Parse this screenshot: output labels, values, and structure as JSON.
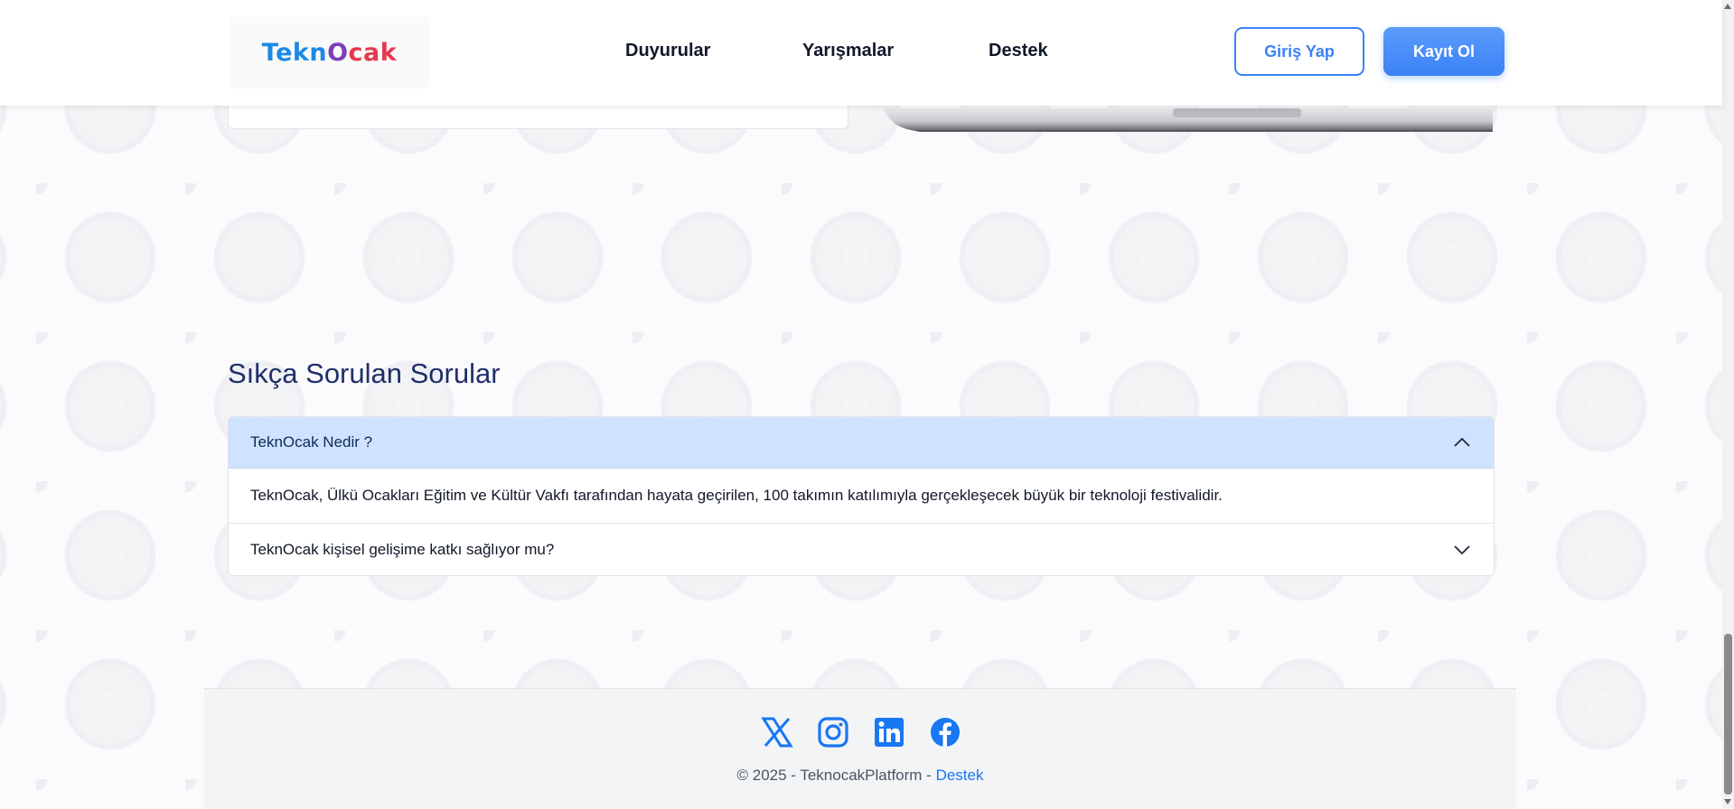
{
  "header": {
    "logo_text": [
      "Tekn",
      "O",
      "cak"
    ],
    "nav": [
      "Duyurular",
      "Yarışmalar",
      "Destek"
    ],
    "login_label": "Giriş Yap",
    "register_label": "Kayıt Ol"
  },
  "faq": {
    "title": "Sıkça Sorulan Sorular",
    "items": [
      {
        "question": "TeknOcak Nedir ?",
        "answer": "TeknOcak, Ülkü Ocakları Eğitim ve Kültür Vakfı tarafından hayata geçirilen, 100 takımın katılımıyla gerçekleşecek büyük bir teknoloji festivalidir.",
        "expanded": true
      },
      {
        "question": "TeknOcak kişisel gelişime katkı sağlıyor mu?",
        "expanded": false
      }
    ]
  },
  "footer": {
    "social_icons": [
      "x-icon",
      "instagram-icon",
      "linkedin-icon",
      "facebook-icon"
    ],
    "copyright": "© 2025 - TeknocakPlatform - ",
    "support_link": "Destek"
  },
  "colors": {
    "primary": "#3b82f6",
    "faq_open_bg": "#cfe2ff",
    "faq_title": "#1e2f6b",
    "link": "#1877f2"
  }
}
